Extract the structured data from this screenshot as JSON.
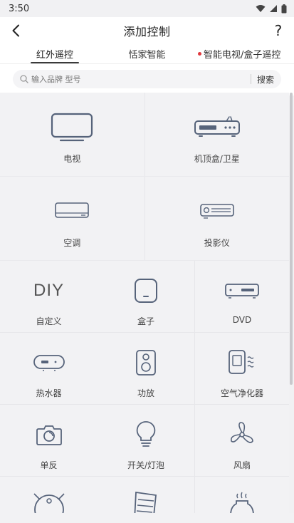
{
  "status": {
    "time": "3:50"
  },
  "header": {
    "title": "添加控制",
    "help": "?"
  },
  "tabs": [
    {
      "label": "红外遥控",
      "active": true
    },
    {
      "label": "恬家智能",
      "active": false
    },
    {
      "label": "智能电视/盒子遥控",
      "active": false,
      "badge": true
    }
  ],
  "search": {
    "placeholder": "输入品牌 型号",
    "button": "搜索"
  },
  "devices_top": [
    {
      "label": "电视",
      "icon": "tv-icon"
    },
    {
      "label": "机顶盒/卫星",
      "icon": "set-top-box-icon"
    },
    {
      "label": "空调",
      "icon": "air-conditioner-icon"
    },
    {
      "label": "投影仪",
      "icon": "projector-icon"
    }
  ],
  "devices_grid": [
    {
      "label": "自定义",
      "icon": "diy-icon",
      "icon_text": "DIY"
    },
    {
      "label": "盒子",
      "icon": "box-icon"
    },
    {
      "label": "DVD",
      "icon": "dvd-icon"
    },
    {
      "label": "热水器",
      "icon": "water-heater-icon"
    },
    {
      "label": "功放",
      "icon": "amplifier-icon"
    },
    {
      "label": "空气净化器",
      "icon": "air-purifier-icon"
    },
    {
      "label": "单反",
      "icon": "camera-icon"
    },
    {
      "label": "开关/灯泡",
      "icon": "light-bulb-icon"
    },
    {
      "label": "风扇",
      "icon": "fan-icon"
    },
    {
      "label": "",
      "icon": "robot-vacuum-icon"
    },
    {
      "label": "",
      "icon": "heater-icon"
    },
    {
      "label": "",
      "icon": "humidifier-icon"
    }
  ]
}
